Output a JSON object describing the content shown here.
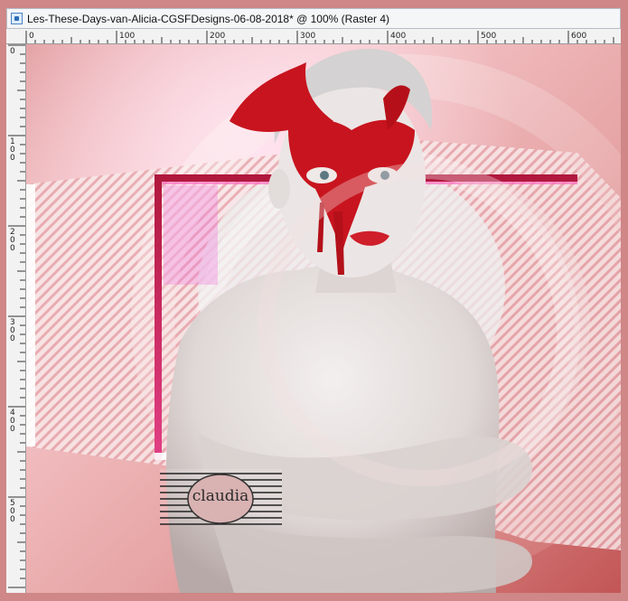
{
  "window": {
    "title": "Les-These-Days-van-Alicia-CGSFDesigns-06-08-2018* @ 100% (Raster 4)",
    "icon": "app-document-icon"
  },
  "ruler": {
    "top_labels": [
      "0",
      "100",
      "200",
      "300",
      "400",
      "500",
      "600"
    ],
    "left_labels": [
      "0",
      "1 0 0",
      "2 0 0",
      "3 0 0",
      "4 0 0",
      "5 0 0"
    ]
  },
  "artwork": {
    "watermark_text": "claudia",
    "colors": {
      "background": "#cf8787",
      "pink_light": "#f4c4c8",
      "magenta": "#cc1f79",
      "mask_red": "#c8141e",
      "skin": "#e8e2e0"
    }
  }
}
